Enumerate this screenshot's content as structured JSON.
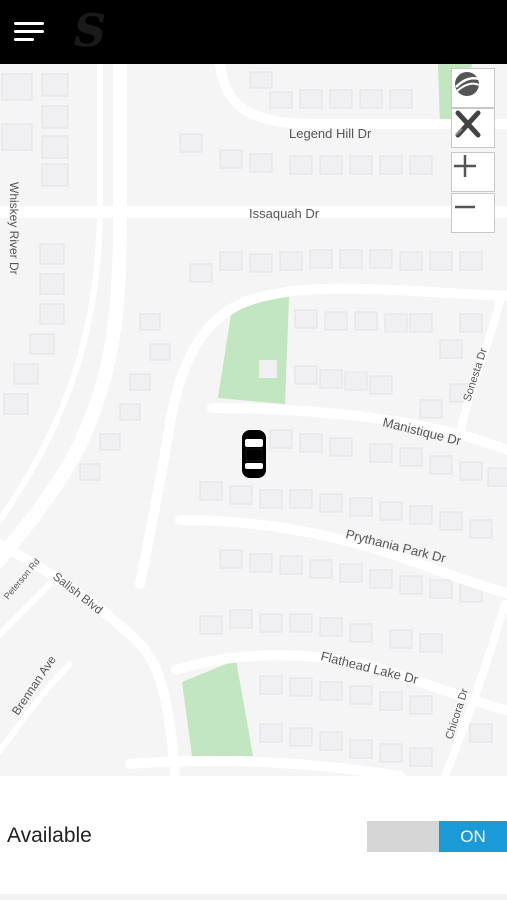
{
  "header": {
    "menu_icon": "hamburger-menu-icon",
    "logo_text": "S"
  },
  "map": {
    "streets": {
      "legend_hill": "Legend Hill Dr",
      "issaquah": "Issaquah Dr",
      "whiskey_river": "Whiskey River Dr",
      "sonesta": "Sonesta Dr",
      "manistique": "Manistique Dr",
      "prythania": "Prythania Park Dr",
      "peterson": "Peterson Rd",
      "salish": "Salish Blvd",
      "brennan": "Brennan Ave",
      "flathead": "Flathead Lake Dr",
      "chicora": "Chicora Dr"
    },
    "controls": {
      "layers_icon": "globe-icon",
      "clear_icon": "marker-remove-icon",
      "zoom_in_icon": "plus-icon",
      "zoom_out_icon": "minus-icon"
    },
    "vehicle_icon": "car-icon",
    "colors": {
      "background": "#f5f5f6",
      "road": "#ffffff",
      "park": "#c2e6bf",
      "building": "#ececee"
    }
  },
  "status": {
    "label": "Available",
    "toggle_on": "ON",
    "toggle_color": "#1a9bd7"
  }
}
